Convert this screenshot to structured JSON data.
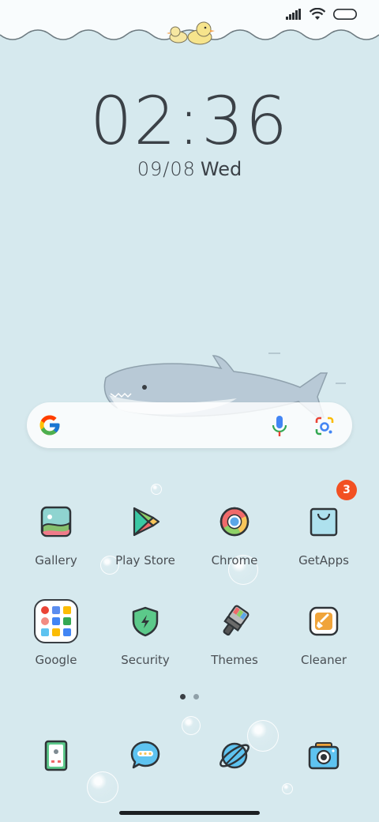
{
  "status_bar": {
    "signal_icon": "signal-bars-icon",
    "wifi_icon": "wifi-icon",
    "battery_icon": "battery-icon"
  },
  "clock": {
    "time": "02:36",
    "date_numeric": "09/08",
    "day": "Wed"
  },
  "search": {
    "google_icon": "google-g-icon",
    "mic_icon": "microphone-icon",
    "lens_icon": "google-lens-icon"
  },
  "apps_row1": [
    {
      "label": "Gallery",
      "icon": "gallery-icon"
    },
    {
      "label": "Play Store",
      "icon": "play-store-icon"
    },
    {
      "label": "Chrome",
      "icon": "chrome-icon"
    },
    {
      "label": "GetApps",
      "icon": "getapps-icon",
      "badge": "3"
    }
  ],
  "apps_row2": [
    {
      "label": "Google",
      "icon": "google-folder-icon"
    },
    {
      "label": "Security",
      "icon": "security-icon"
    },
    {
      "label": "Themes",
      "icon": "themes-icon"
    },
    {
      "label": "Cleaner",
      "icon": "cleaner-icon"
    }
  ],
  "page_indicator": {
    "pages": 2,
    "current": 1
  },
  "dock": [
    {
      "icon": "phone-icon"
    },
    {
      "icon": "messages-icon"
    },
    {
      "icon": "browser-icon"
    },
    {
      "icon": "camera-icon"
    }
  ],
  "colors": {
    "background": "#d6e9ee",
    "badge": "#f25022",
    "outline": "#3a3f44"
  }
}
